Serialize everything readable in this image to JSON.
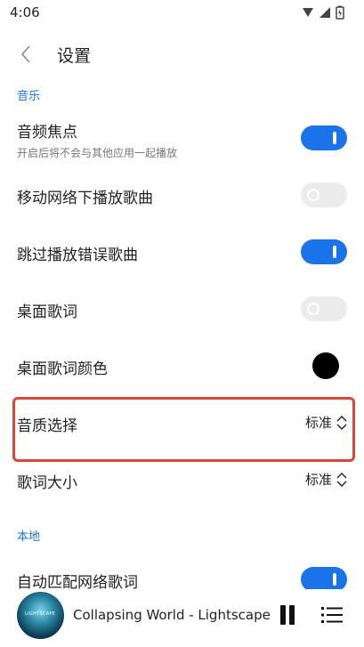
{
  "status_bar": {
    "time": "4:06"
  },
  "header": {
    "title": "设置"
  },
  "sections": {
    "music": "音乐",
    "local": "本地"
  },
  "settings": {
    "audio_focus": {
      "title": "音频焦点",
      "subtitle": "开启后将不会与其他应用一起播放",
      "enabled": true
    },
    "mobile_network_play": {
      "title": "移动网络下播放歌曲",
      "enabled": false
    },
    "skip_error_songs": {
      "title": "跳过播放错误歌曲",
      "enabled": true
    },
    "desktop_lyrics": {
      "title": "桌面歌词",
      "enabled": false
    },
    "desktop_lyrics_color": {
      "title": "桌面歌词颜色",
      "color": "#000000"
    },
    "audio_quality": {
      "title": "音质选择",
      "value": "标准"
    },
    "lyrics_size": {
      "title": "歌词大小",
      "value": "标准"
    },
    "auto_match_lyrics": {
      "title": "自动匹配网络歌词",
      "enabled": true
    }
  },
  "player": {
    "track": "Collapsing World - Lightscape",
    "album_art_text": "LIGHTSCAPE"
  },
  "colors": {
    "accent": "#1a73e8",
    "section": "#1877e0",
    "highlight": "#d9473b"
  }
}
